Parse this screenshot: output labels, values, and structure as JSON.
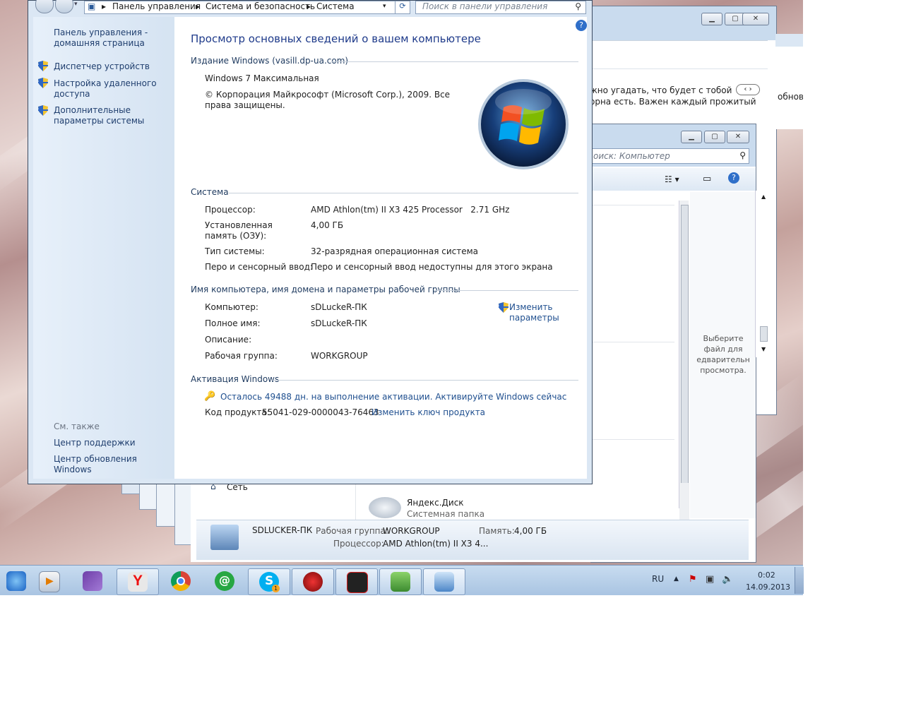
{
  "address_bar": {
    "crumbs": [
      "Панель управления",
      "Система и безопасность",
      "Система"
    ]
  },
  "search": {
    "placeholder": "Поиск в панели управления"
  },
  "sidebar": {
    "home": "Панель управления - домашняя страница",
    "items": [
      {
        "label": "Диспетчер устройств"
      },
      {
        "label": "Настройка удаленного доступа"
      },
      {
        "label": "Дополнительные параметры системы"
      }
    ],
    "see_also_title": "См. также",
    "see_also": [
      "Центр поддержки",
      "Центр обновления Windows"
    ]
  },
  "main": {
    "title": "Просмотр основных сведений о вашем компьютере",
    "edition_header": "Издание Windows (vasill.dp-ua.com)",
    "edition_name": "Windows 7 Максимальная",
    "copyright": "© Корпорация Майкрософт (Microsoft Corp.), 2009. Все права защищены.",
    "system_header": "Система",
    "system_rows": [
      {
        "label": "Процессор:",
        "value": "AMD Athlon(tm) II X3 425 Processor   2.71 GHz"
      },
      {
        "label": "Установленная память (ОЗУ):",
        "value": "4,00 ГБ"
      },
      {
        "label": "Тип системы:",
        "value": "32-разрядная операционная система"
      },
      {
        "label": "Перо и сенсорный ввод:",
        "value": "Перо и сенсорный ввод недоступны для этого экрана"
      }
    ],
    "computer_header": "Имя компьютера, имя домена и параметры рабочей группы",
    "computer_rows": [
      {
        "label": "Компьютер:",
        "value": "sDLuckeR-ПК"
      },
      {
        "label": "Полное имя:",
        "value": "sDLuckeR-ПК"
      },
      {
        "label": "Описание:",
        "value": ""
      },
      {
        "label": "Рабочая группа:",
        "value": "WORKGROUP"
      }
    ],
    "change_settings": "Изменить параметры",
    "activation_header": "Активация Windows",
    "activation_text": "Осталось 49488 дн. на выполнение активации. Активируйте Windows сейчас",
    "product_key_label": "Код продукта:",
    "product_key": "55041-029-0000043-76463",
    "change_key": "Изменить ключ продукта"
  },
  "back_window": {
    "text_line1": "жно угадать, что будет с тобой",
    "text_line2": "орна есть. Важен каждый прожитый",
    "side_text": "обнов.",
    "search_placeholder": "оиск: Компьютер",
    "preview_text": "Выберите файл для едварительн просмотра.",
    "nav_network": "Сеть",
    "item_name": "Яндекс.Диск",
    "item_type": "Системная папка",
    "details": {
      "pc_name": "SDLUCKER-ПК",
      "workgroup_label": "Рабочая группа:",
      "workgroup": "WORKGROUP",
      "memory_label": "Память:",
      "memory": "4,00 ГБ",
      "cpu_label": "Процессор:",
      "cpu": "AMD Athlon(tm) II X3 4..."
    }
  },
  "taskbar": {
    "lang": "RU",
    "time": "0:02",
    "date": "14.09.2013",
    "apps": [
      "internet-explorer-icon",
      "media-player-icon",
      "visual-studio-icon",
      "yandex-browser-icon",
      "chrome-icon",
      "icq-icon",
      "skype-icon",
      "hacker-app-icon",
      "gaming-app-icon",
      "security-center-icon",
      "control-panel-icon"
    ],
    "skype_badge": "1"
  }
}
